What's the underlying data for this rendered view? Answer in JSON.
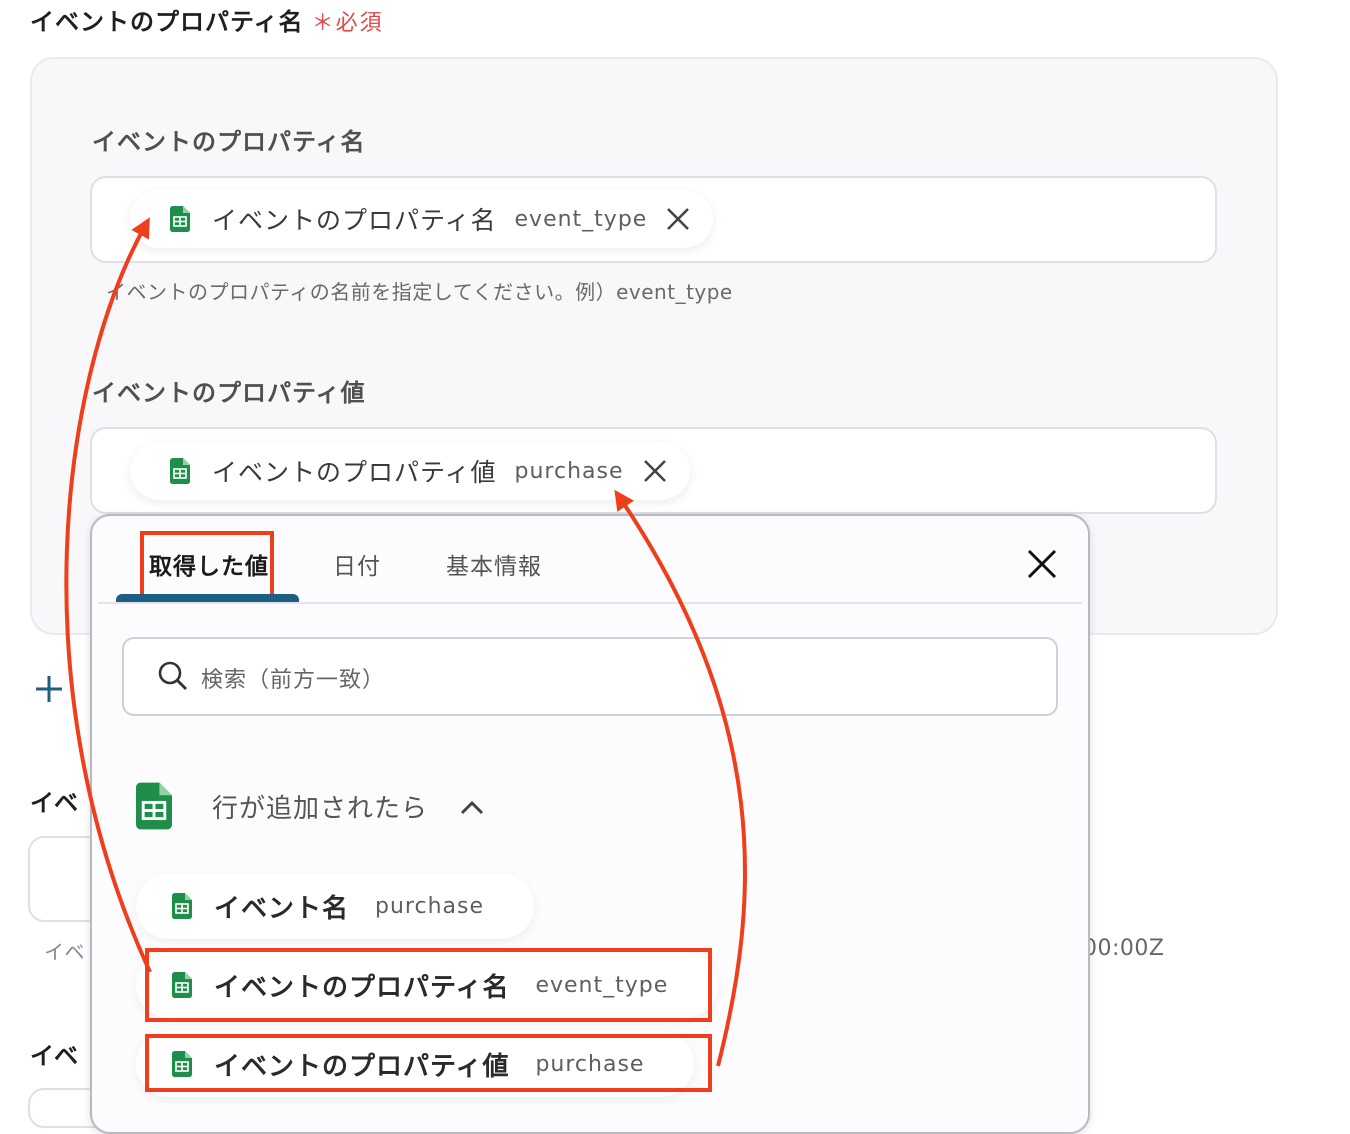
{
  "section": {
    "title": "イベントのプロパティ名",
    "required_label": "＊必須"
  },
  "fields": [
    {
      "label": "イベントのプロパティ名",
      "chip_name": "イベントのプロパティ名",
      "chip_value": "event_type",
      "hint": "イベントのプロパティの名前を指定してください。例）event_type"
    },
    {
      "label": "イベントのプロパティ値",
      "chip_name": "イベントのプロパティ値",
      "chip_value": "purchase"
    }
  ],
  "background_peek": {
    "labels": [
      "イベ",
      "イベ"
    ],
    "hint_start": "イベ",
    "hint_end": "00:00Z",
    "add_symbol": "+"
  },
  "popup": {
    "tabs": [
      "取得した値",
      "日付",
      "基本情報"
    ],
    "active_tab_index": 0,
    "search_placeholder": "検索（前方一致）",
    "group": {
      "title": "行が追加されたら",
      "items": [
        {
          "name": "イベント名",
          "value": "purchase"
        },
        {
          "name": "イベントのプロパティ名",
          "value": "event_type"
        },
        {
          "name": "イベントのプロパティ値",
          "value": "purchase"
        }
      ]
    }
  },
  "colors": {
    "accent_highlight": "#ef3e1b",
    "tab_underline": "#1d5f82",
    "sheets_green": "#1e8e4a",
    "required_red": "#e5484d",
    "add_plus": "#1d5f82"
  },
  "icons": [
    "google-sheets-icon",
    "close-icon",
    "search-icon",
    "chevron-up-icon",
    "plus-icon"
  ]
}
